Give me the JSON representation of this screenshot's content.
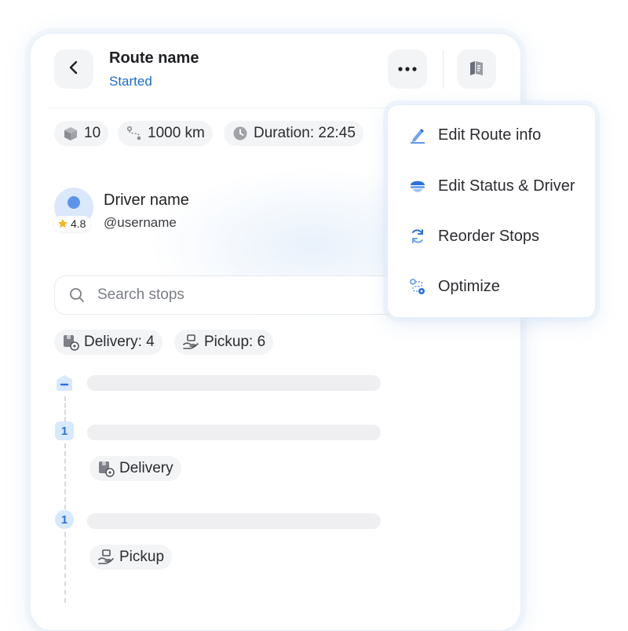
{
  "header": {
    "back_icon": "chevron-left-icon",
    "title": "Route name",
    "status": "Started",
    "more_icon": "more-horizontal-icon",
    "map_icon": "map-book-icon"
  },
  "stats": {
    "packages": "10",
    "distance": "1000 km",
    "duration": "Duration: 22:45"
  },
  "driver": {
    "name": "Driver name",
    "username": "@username",
    "rating": "4.8"
  },
  "search": {
    "placeholder": "Search stops"
  },
  "filters": {
    "delivery": "Delivery: 4",
    "pickup": "Pickup: 6"
  },
  "stops": {
    "first_badge": "–",
    "items": [
      {
        "number": "1",
        "type": "Delivery"
      },
      {
        "number": "1",
        "type": "Pickup"
      }
    ]
  },
  "menu": {
    "items": [
      {
        "label": "Edit Route info",
        "icon": "pencil-icon"
      },
      {
        "label": "Edit Status & Driver",
        "icon": "driver-cap-icon"
      },
      {
        "label": "Reorder Stops",
        "icon": "refresh-icon"
      },
      {
        "label": "Optimize",
        "icon": "route-optimize-icon"
      }
    ]
  },
  "colors": {
    "accent": "#1d6ad3",
    "chip_bg": "#f3f4f6",
    "badge_bg": "#d8e8fd"
  }
}
